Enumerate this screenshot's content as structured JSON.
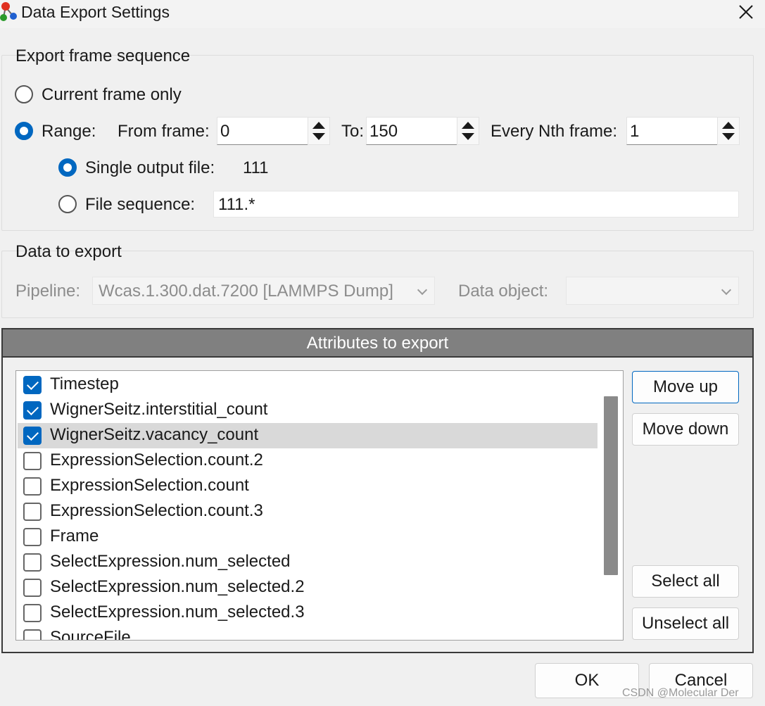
{
  "window": {
    "title": "Data Export Settings"
  },
  "export_frame_sequence": {
    "title": "Export frame sequence",
    "current_frame_only_label": "Current frame only",
    "range_label": "Range:",
    "from_frame_label": "From frame:",
    "from_frame_value": "0",
    "to_label": "To:",
    "to_value": "150",
    "every_nth_label": "Every Nth frame:",
    "every_nth_value": "1",
    "single_output_label": "Single output file:",
    "single_output_value": "111",
    "file_sequence_label": "File sequence:",
    "file_sequence_value": "111.*",
    "selected_mode": "range",
    "selected_output": "single"
  },
  "data_to_export": {
    "title": "Data to export",
    "pipeline_label": "Pipeline:",
    "pipeline_value": "Wcas.1.300.dat.7200 [LAMMPS Dump]",
    "data_object_label": "Data object:",
    "data_object_value": ""
  },
  "attributes": {
    "header": "Attributes to export",
    "items": [
      {
        "label": "Timestep",
        "checked": true
      },
      {
        "label": "WignerSeitz.interstitial_count",
        "checked": true
      },
      {
        "label": "WignerSeitz.vacancy_count",
        "checked": true,
        "selected": true
      },
      {
        "label": "ExpressionSelection.count.2",
        "checked": false
      },
      {
        "label": "ExpressionSelection.count",
        "checked": false
      },
      {
        "label": "ExpressionSelection.count.3",
        "checked": false
      },
      {
        "label": "Frame",
        "checked": false
      },
      {
        "label": "SelectExpression.num_selected",
        "checked": false
      },
      {
        "label": "SelectExpression.num_selected.2",
        "checked": false
      },
      {
        "label": "SelectExpression.num_selected.3",
        "checked": false
      },
      {
        "label": "SourceFile",
        "checked": false
      }
    ],
    "move_up_label": "Move up",
    "move_down_label": "Move down",
    "select_all_label": "Select all",
    "unselect_all_label": "Unselect all"
  },
  "footer": {
    "ok_label": "OK",
    "cancel_label": "Cancel",
    "watermark": "CSDN @Molecular Der"
  },
  "colors": {
    "accent": "#0067c0",
    "header_bg": "#808080"
  }
}
